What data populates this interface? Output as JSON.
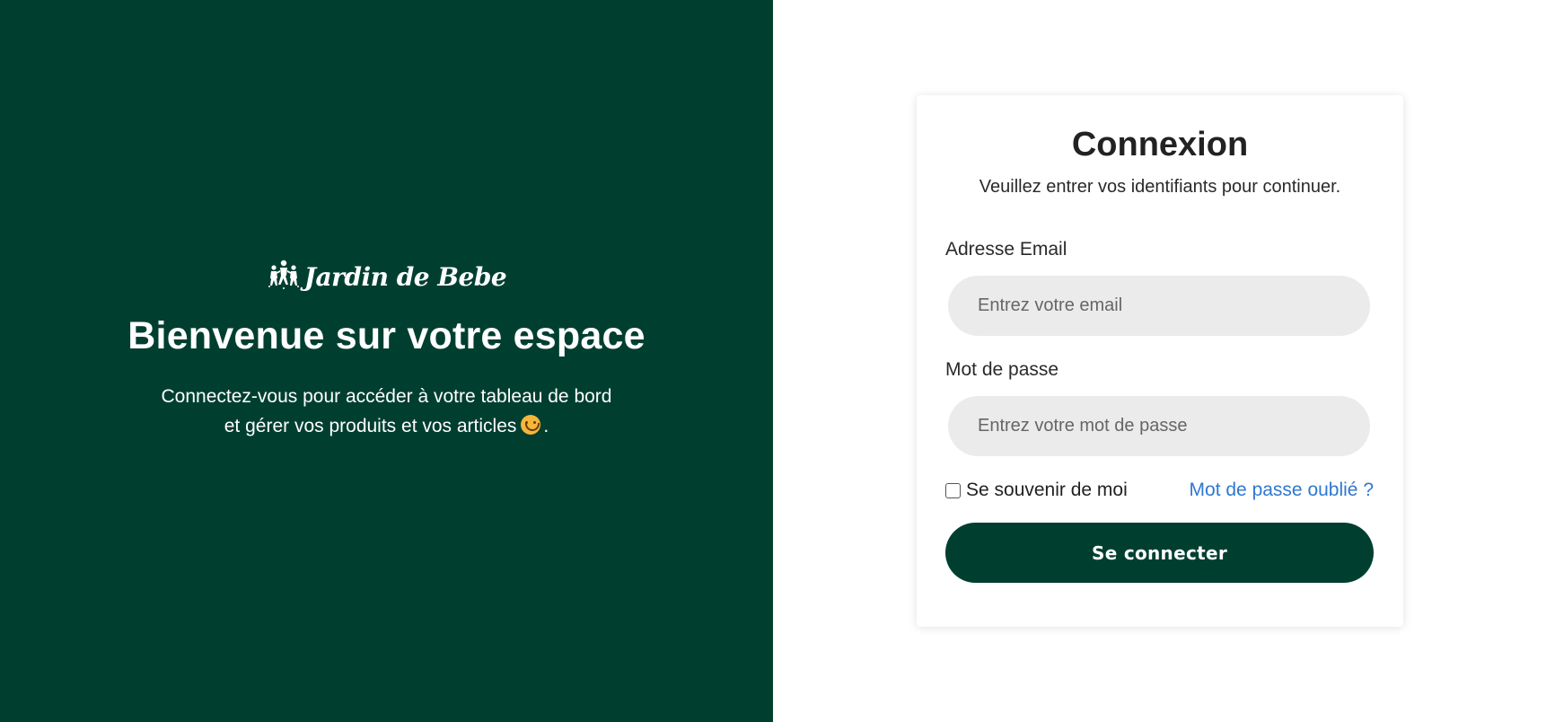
{
  "brand": {
    "logo_text": "Jardin de Bebe",
    "icon": "family-icon"
  },
  "welcome": {
    "title": "Bienvenue sur votre espace",
    "line1": "Connectez-vous pour accéder à votre tableau de bord",
    "line2": "et gérer vos produits et vos articles",
    "emoji": "smiling-face-icon",
    "line2_end": "."
  },
  "login": {
    "title": "Connexion",
    "subtitle": "Veuillez entrer vos identifiants pour continuer.",
    "email_label": "Adresse Email",
    "email_placeholder": "Entrez votre email",
    "email_value": "",
    "password_label": "Mot de passe",
    "password_placeholder": "Entrez votre mot de passe",
    "password_value": "",
    "remember_label": "Se souvenir de moi",
    "remember_checked": false,
    "forgot_label": "Mot de passe oublié ?",
    "submit_label": "Se connecter"
  },
  "colors": {
    "brand_green": "#003f30",
    "link_blue": "#2e78d0",
    "input_bg": "#ebebeb"
  }
}
